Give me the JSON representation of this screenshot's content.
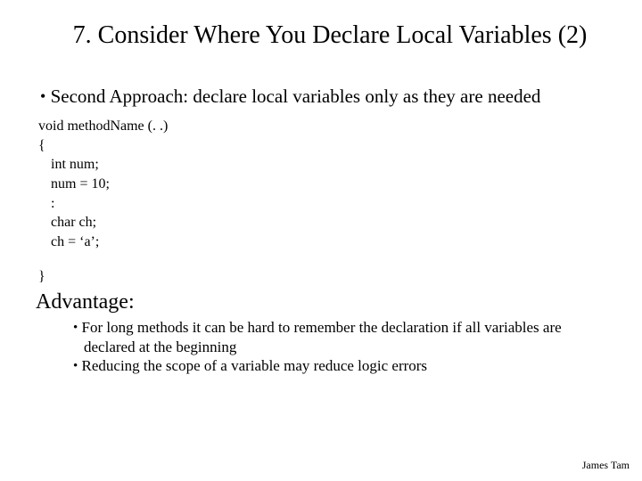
{
  "title": "7. Consider Where You Declare Local Variables (2)",
  "main_bullet": "Second Approach: declare local variables only as they are needed",
  "code": {
    "l1": "void methodName (. .)",
    "l2": "{",
    "l3": "int num;",
    "l4": "num = 10;",
    "l5": "   :",
    "l6": "char ch;",
    "l7": "ch = ‘a’;",
    "l8": "}"
  },
  "advantage_heading": "Advantage:",
  "sub_bullet_1": "For long methods it can be hard to remember the declaration if all variables are declared at the beginning",
  "sub_bullet_2": "Reducing the scope of a variable may reduce logic errors",
  "footer": "James Tam"
}
